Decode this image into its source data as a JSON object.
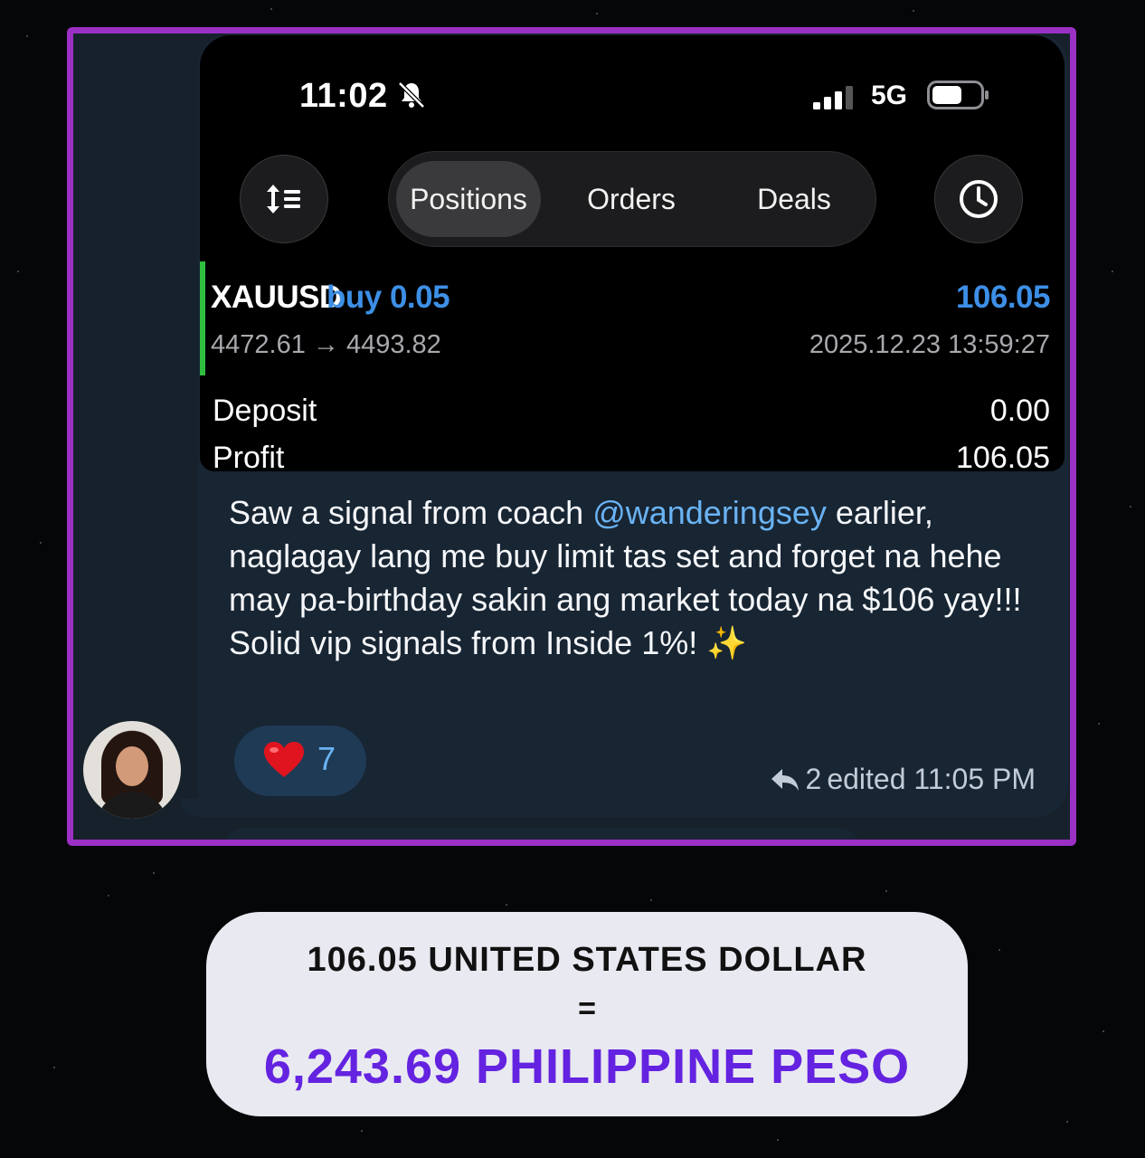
{
  "status_bar": {
    "time": "11:02",
    "network": "5G"
  },
  "tabs": [
    {
      "label": "Positions",
      "active": true
    },
    {
      "label": "Orders",
      "active": false
    },
    {
      "label": "Deals",
      "active": false
    }
  ],
  "position": {
    "symbol": "XAUUSD",
    "side_volume": "buy 0.05",
    "profit": "106.05",
    "prices": "4472.61 → 4493.82",
    "datetime": "2025.12.23 13:59:27"
  },
  "summary": {
    "deposit_label": "Deposit",
    "deposit_value": "0.00",
    "profit_label": "Profit",
    "profit_value": "106.05"
  },
  "message": {
    "text_before": "Saw a signal from coach ",
    "mention": "@wanderingsey",
    "text_after": " earlier, naglagay lang me buy limit tas set and forget na hehe may pa-birthday sakin ang market today na $106 yay!!! Solid vip signals from Inside 1%! ✨",
    "reaction_emoji": "❤️",
    "reaction_count": "7",
    "replies": "2",
    "edited": "edited 11:05 PM"
  },
  "conversion": {
    "from": "106.05 UNITED STATES DOLLAR",
    "equals": "=",
    "to": "6,243.69 PHILIPPINE PESO"
  },
  "colors": {
    "frame": "#9b30c4",
    "accent_blue": "#3d8fe6",
    "converted_purple": "#6423e0",
    "trade_green": "#2fbf3f"
  }
}
